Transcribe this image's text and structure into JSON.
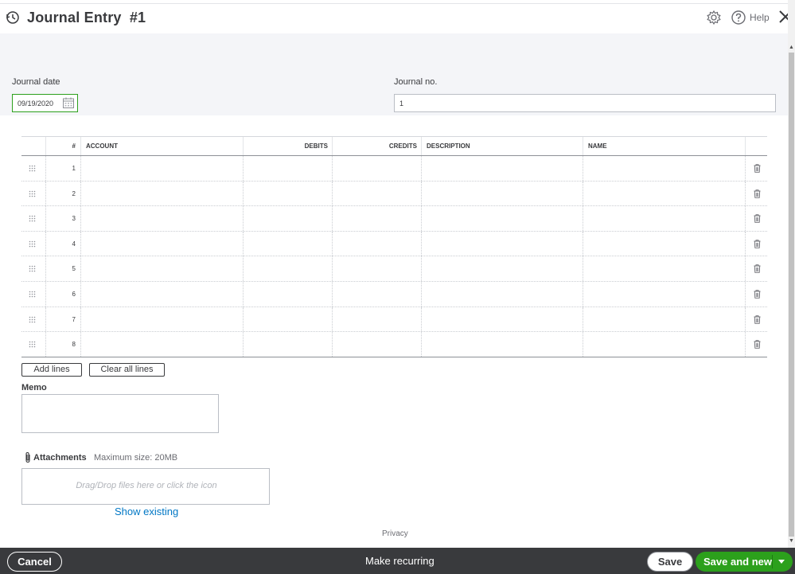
{
  "header": {
    "title": "Journal Entry",
    "entry_number": "#1",
    "help_label": "Help"
  },
  "form": {
    "journal_date_label": "Journal date",
    "journal_date_value": "09/19/2020",
    "journal_no_label": "Journal no.",
    "journal_no_value": "1"
  },
  "table": {
    "columns": [
      "#",
      "ACCOUNT",
      "DEBITS",
      "CREDITS",
      "DESCRIPTION",
      "NAME"
    ],
    "rows": [
      "1",
      "2",
      "3",
      "4",
      "5",
      "6",
      "7",
      "8"
    ]
  },
  "actions": {
    "add_lines": "Add lines",
    "clear_all_lines": "Clear all lines"
  },
  "memo": {
    "label": "Memo"
  },
  "attachments": {
    "label": "Attachments",
    "max_size": "Maximum size: 20MB",
    "drop_hint": "Drag/Drop files here or click the icon",
    "show_existing": "Show existing"
  },
  "privacy": "Privacy",
  "footer": {
    "cancel": "Cancel",
    "make_recurring": "Make recurring",
    "save": "Save",
    "save_and_new": "Save and new"
  },
  "colors": {
    "accent_green": "#2ca01c",
    "footer_bg": "#393a3d",
    "link_blue": "#0077c5"
  }
}
